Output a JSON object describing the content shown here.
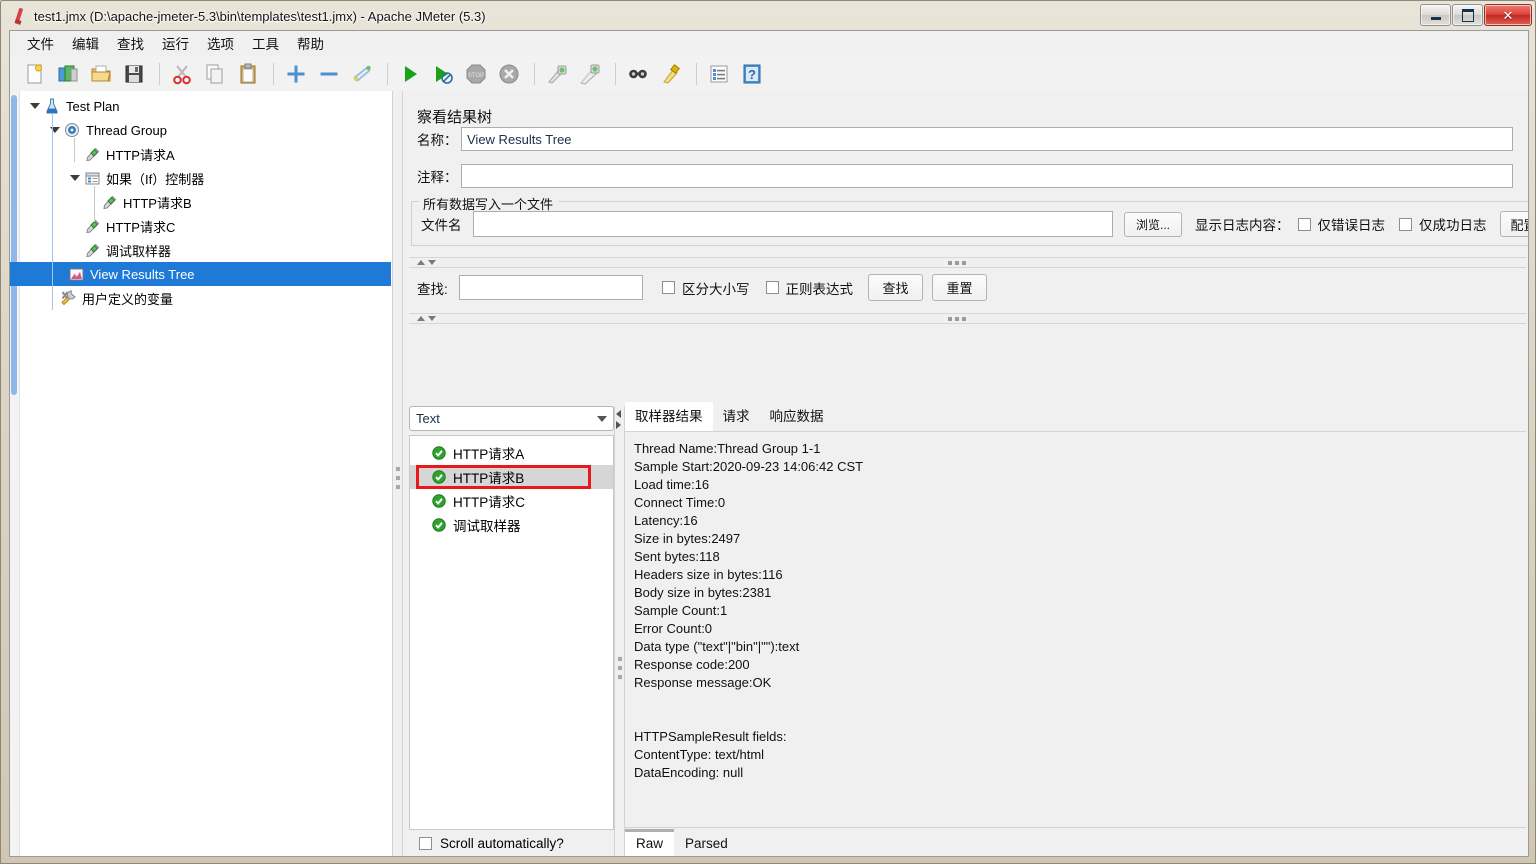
{
  "window": {
    "title": "test1.jmx (D:\\apache-jmeter-5.3\\bin\\templates\\test1.jmx) - Apache JMeter (5.3)",
    "icon": "jmeter-feather-icon",
    "minimize_label": "",
    "maximize_label": "",
    "close_label": "✕"
  },
  "menubar": {
    "items": [
      {
        "label": "文件",
        "name": "menu-file"
      },
      {
        "label": "编辑",
        "name": "menu-edit"
      },
      {
        "label": "查找",
        "name": "menu-search"
      },
      {
        "label": "运行",
        "name": "menu-run"
      },
      {
        "label": "选项",
        "name": "menu-options"
      },
      {
        "label": "工具",
        "name": "menu-tools"
      },
      {
        "label": "帮助",
        "name": "menu-help"
      }
    ]
  },
  "toolbar": {
    "buttons": [
      {
        "name": "new-icon"
      },
      {
        "name": "templates-icon"
      },
      {
        "name": "open-icon"
      },
      {
        "name": "save-icon"
      },
      {
        "name": "cut-icon"
      },
      {
        "name": "copy-icon"
      },
      {
        "name": "paste-icon"
      },
      {
        "name": "expand-all-icon"
      },
      {
        "name": "collapse-all-icon"
      },
      {
        "name": "toggle-icon"
      },
      {
        "name": "start-icon"
      },
      {
        "name": "start-no-timers-icon"
      },
      {
        "name": "stop-icon"
      },
      {
        "name": "shutdown-icon"
      },
      {
        "name": "clear-icon"
      },
      {
        "name": "clear-all-icon"
      },
      {
        "name": "search-icon"
      },
      {
        "name": "search-reset-icon"
      },
      {
        "name": "function-helper-icon"
      },
      {
        "name": "help-icon"
      }
    ]
  },
  "tree": {
    "nodes": [
      {
        "label": "Test Plan",
        "icon": "test-plan-icon",
        "depth": 0,
        "expander": "expanded",
        "selected": false
      },
      {
        "label": "Thread Group",
        "icon": "thread-group-icon",
        "depth": 1,
        "expander": "expanded",
        "selected": false
      },
      {
        "label": "HTTP请求A",
        "icon": "http-sampler-icon",
        "depth": 2,
        "expander": "none",
        "selected": false
      },
      {
        "label": "如果（If）控制器",
        "icon": "if-controller-icon",
        "depth": 2,
        "expander": "expanded",
        "selected": false
      },
      {
        "label": "HTTP请求B",
        "icon": "http-sampler-icon",
        "depth": 3,
        "expander": "none",
        "selected": false
      },
      {
        "label": "HTTP请求C",
        "icon": "http-sampler-icon",
        "depth": 2,
        "expander": "none",
        "selected": false
      },
      {
        "label": "调试取样器",
        "icon": "debug-sampler-icon",
        "depth": 2,
        "expander": "none",
        "selected": false
      },
      {
        "label": "View Results Tree",
        "icon": "view-results-tree-icon",
        "depth": 2,
        "expander": "none",
        "selected": true
      },
      {
        "label": "用户定义的变量",
        "icon": "user-defined-variables-icon",
        "depth": 1,
        "expander": "none",
        "selected": false
      }
    ]
  },
  "panel": {
    "title": "察看结果树",
    "name_label": "名称：",
    "name_value": "View Results Tree",
    "comment_label": "注释：",
    "comment_value": "",
    "group_title": "所有数据写入一个文件",
    "filename_label": "文件名",
    "filename_value": "",
    "browse_label": "浏览...",
    "log_display_label": "显示日志内容：",
    "errors_only_label": "仅错误日志",
    "errors_only_checked": false,
    "success_only_label": "仅成功日志",
    "success_only_checked": false,
    "configure_label": "配置"
  },
  "search_bar": {
    "label": "查找:",
    "value": "",
    "case_sensitive_label": "区分大小写",
    "case_sensitive_checked": false,
    "regex_label": "正则表达式",
    "regex_checked": false,
    "search_button": "查找",
    "reset_button": "重置"
  },
  "results": {
    "renderer_selected": "Text",
    "renderer_options": [
      "Text"
    ],
    "samplers": [
      {
        "label": "HTTP请求A",
        "status": "success",
        "selected": false,
        "highlighted": false
      },
      {
        "label": "HTTP请求B",
        "status": "success",
        "selected": true,
        "highlighted": true
      },
      {
        "label": "HTTP请求C",
        "status": "success",
        "selected": false,
        "highlighted": false
      },
      {
        "label": "调试取样器",
        "status": "success",
        "selected": false,
        "highlighted": false
      }
    ],
    "scroll_automatically_label": "Scroll automatically?",
    "scroll_automatically_checked": false,
    "tabs": [
      {
        "label": "取样器结果",
        "active": true
      },
      {
        "label": "请求",
        "active": false
      },
      {
        "label": "响应数据",
        "active": false
      }
    ],
    "sampler_result_text": "Thread Name:Thread Group 1-1\nSample Start:2020-09-23 14:06:42 CST\nLoad time:16\nConnect Time:0\nLatency:16\nSize in bytes:2497\nSent bytes:118\nHeaders size in bytes:116\nBody size in bytes:2381\nSample Count:1\nError Count:0\nData type (\"text\"|\"bin\"|\"\"):text\nResponse code:200\nResponse message:OK\n\n\nHTTPSampleResult fields:\nContentType: text/html\nDataEncoding: null",
    "bottom_tabs": [
      {
        "label": "Raw",
        "active": true
      },
      {
        "label": "Parsed",
        "active": false
      }
    ]
  },
  "colors": {
    "selection_blue": "#1e7ad6",
    "highlight_red": "#e8191d",
    "success_green": "#2fa32f",
    "panel_bg": "#f0f0f0"
  }
}
